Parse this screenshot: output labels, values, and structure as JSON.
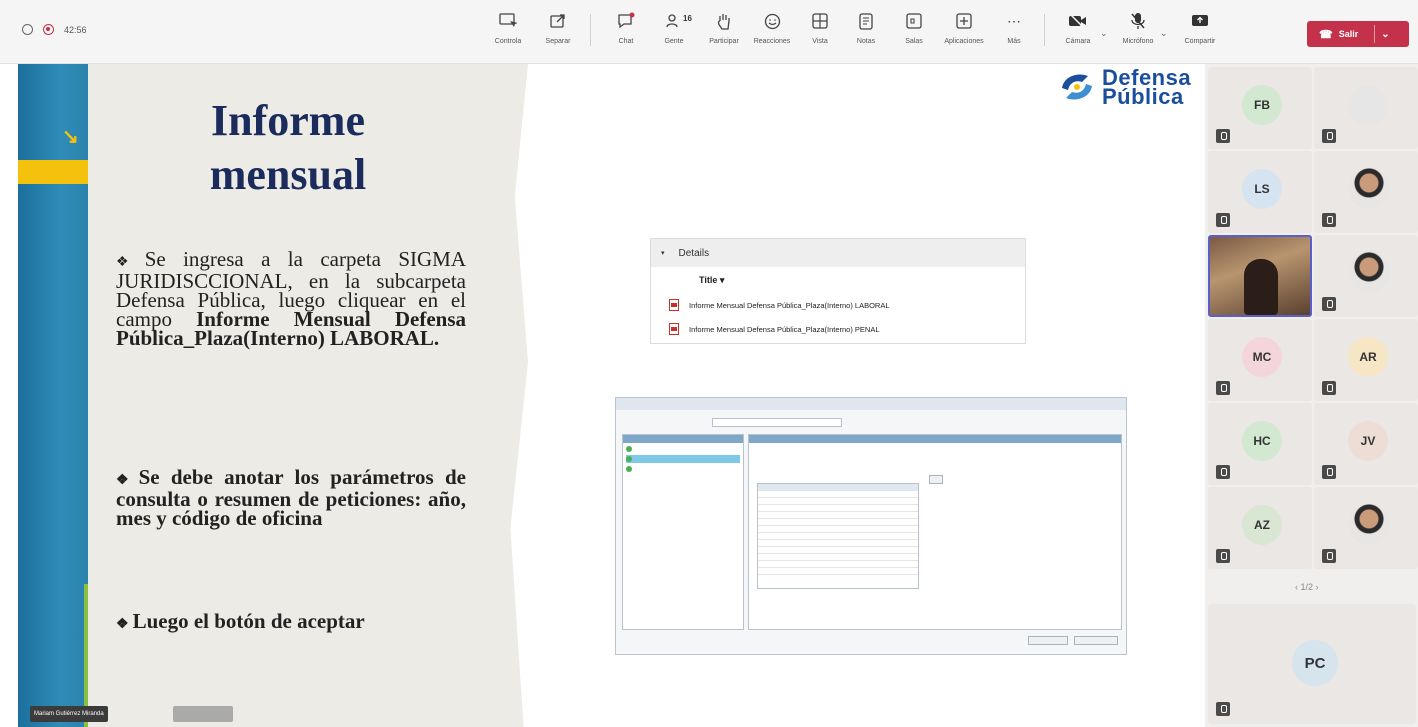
{
  "meeting": {
    "timer": "42:56"
  },
  "toolbar": {
    "items": [
      {
        "label": "Controla"
      },
      {
        "label": "Separar"
      },
      {
        "label": "Chat"
      },
      {
        "label": "Gente",
        "count": "16"
      },
      {
        "label": "Participar"
      },
      {
        "label": "Reacciones"
      },
      {
        "label": "Vista"
      },
      {
        "label": "Notas"
      },
      {
        "label": "Salas"
      },
      {
        "label": "Aplicaciones"
      },
      {
        "label": "Más"
      },
      {
        "label": "Cámara"
      },
      {
        "label": "Micrófono"
      },
      {
        "label": "Compartir"
      }
    ],
    "leave_label": "Salir",
    "leave_color": "#c4314b"
  },
  "slide": {
    "title": "Informe mensual",
    "bullet1_plain": "Se ingresa a la carpeta SIGMA JURIDISCCIONAL, en la subcarpeta Defensa Pública, luego cliquear en el campo ",
    "bullet1_bold": "Informe Mensual Defensa Pública_Plaza(Interno) LABORAL.",
    "bullet2": "Se debe anotar los parámetros de consulta o resumen de peticiones: año, mes y código de oficina",
    "bullet3": "Luego el botón de aceptar",
    "logo_line1": "Defensa",
    "logo_line2": "Pública",
    "details": {
      "header": "Details",
      "column": "Title",
      "rows": [
        "Informe Mensual Defensa Pública_Plaza(Interno) LABORAL",
        "Informe Mensual Defensa Pública_Plaza(Interno) PENAL"
      ]
    }
  },
  "participants": [
    {
      "initials": "FB",
      "bg": "#d3e8d0"
    },
    {
      "initials": "",
      "bg": "#e6e6e6"
    },
    {
      "initials": "LS",
      "bg": "#d6e4f2"
    },
    {
      "initials": "",
      "bg": "photo"
    },
    {
      "initials": "",
      "bg": "video"
    },
    {
      "initials": "",
      "bg": "photo"
    },
    {
      "initials": "MC",
      "bg": "#f5d5dc"
    },
    {
      "initials": "AR",
      "bg": "#f7e6c6"
    },
    {
      "initials": "HC",
      "bg": "#d3e8d0"
    },
    {
      "initials": "JV",
      "bg": "#eedcd6"
    },
    {
      "initials": "AZ",
      "bg": "#d9e6d3"
    },
    {
      "initials": "",
      "bg": "photo"
    }
  ],
  "pager": "1/2",
  "presenter_tile": {
    "initials": "PC",
    "bg": "#d6e4ee"
  },
  "active_speaker": "Mariam Gutiérrez Miranda"
}
